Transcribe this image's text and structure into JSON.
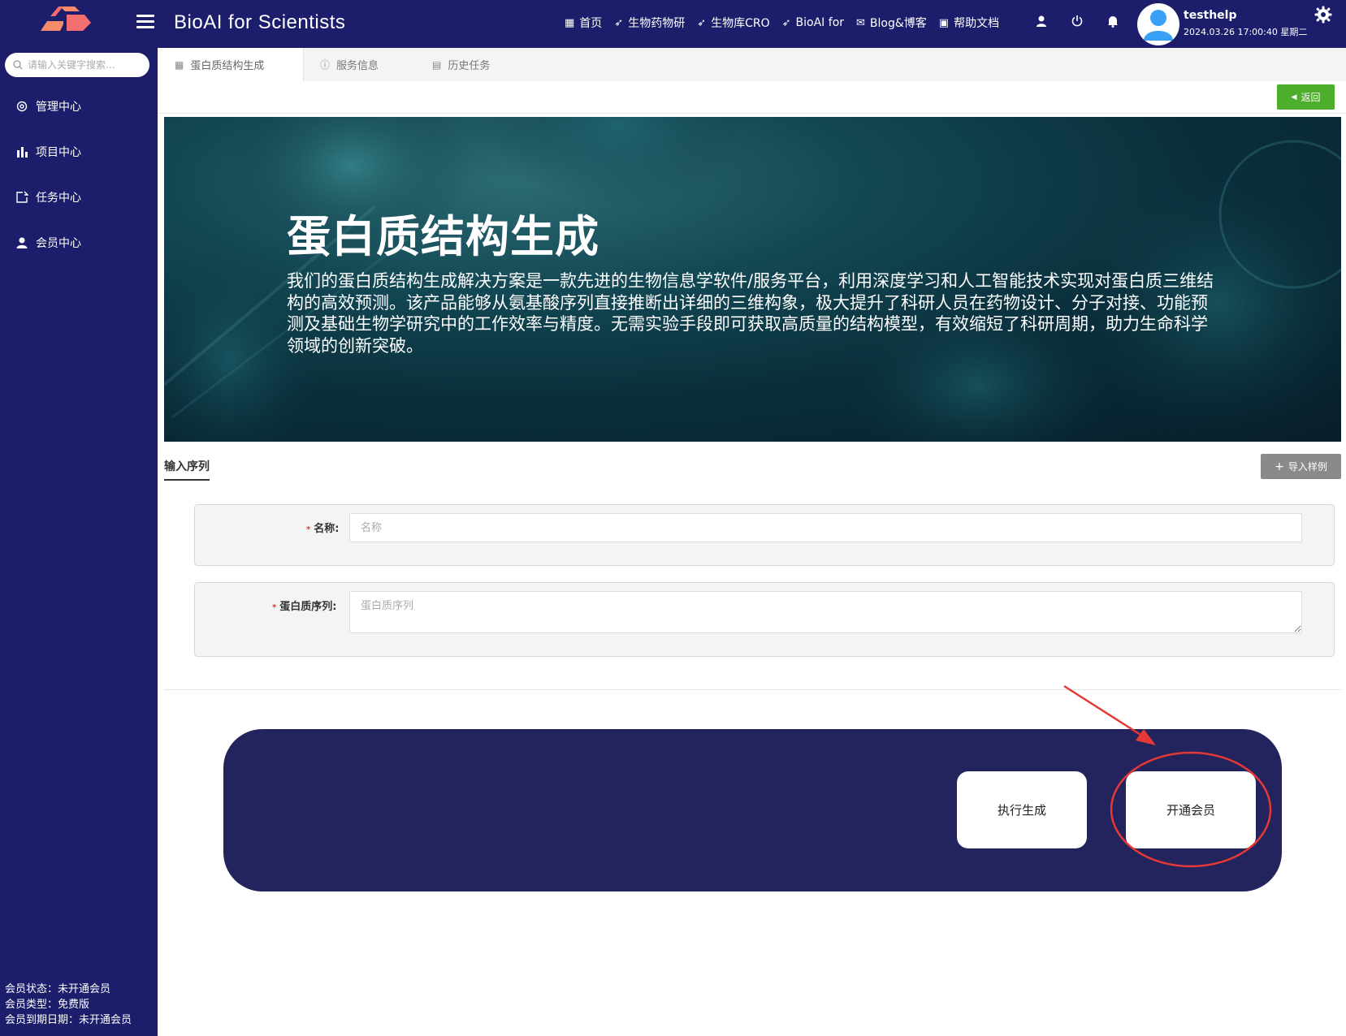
{
  "header": {
    "title": "BioAI for Scientists",
    "nav": [
      {
        "label": "首页",
        "icon": "grid-icon"
      },
      {
        "label": "生物药物研",
        "icon": "send-icon"
      },
      {
        "label": "生物库CRO",
        "icon": "send-icon"
      },
      {
        "label": "BioAI for",
        "icon": "send-icon"
      },
      {
        "label": "Blog&博客",
        "icon": "chat-icon"
      },
      {
        "label": "帮助文档",
        "icon": "doc-icon"
      }
    ],
    "user": {
      "name": "testhelp",
      "datetime": "2024.03.26 17:00:40 星期二"
    }
  },
  "sidebar": {
    "search_placeholder": "请输入关键字搜索...",
    "items": [
      {
        "label": "管理中心",
        "icon": "gear-icon"
      },
      {
        "label": "项目中心",
        "icon": "bar-chart-icon"
      },
      {
        "label": "任务中心",
        "icon": "share-icon"
      },
      {
        "label": "会员中心",
        "icon": "user-icon"
      }
    ],
    "member": {
      "status": "会员状态：未开通会员",
      "type": "会员类型：免费版",
      "expiry": "会员到期日期：未开通会员"
    }
  },
  "tabs": [
    {
      "label": "蛋白质结构生成",
      "icon": "grid-icon",
      "active": true
    },
    {
      "label": "服务信息",
      "icon": "info-icon",
      "active": false
    },
    {
      "label": "历史任务",
      "icon": "doc-icon",
      "active": false
    }
  ],
  "toolbar": {
    "back_label": "返回"
  },
  "banner": {
    "title": "蛋白质结构生成",
    "description": "我们的蛋白质结构生成解决方案是一款先进的生物信息学软件/服务平台，利用深度学习和人工智能技术实现对蛋白质三维结构的高效预测。该产品能够从氨基酸序列直接推断出详细的三维构象，极大提升了科研人员在药物设计、分子对接、功能预测及基础生物学研究中的工作效率与精度。无需实验手段即可获取高质量的结构模型，有效缩短了科研周期，助力生命科学领域的创新突破。"
  },
  "form": {
    "section_title": "输入序列",
    "import_label": "导入样例",
    "name_label": "名称:",
    "name_placeholder": "名称",
    "seq_label": "蛋白质序列:",
    "seq_placeholder": "蛋白质序列"
  },
  "actions": {
    "run_label": "执行生成",
    "member_label": "开通会员"
  },
  "colors": {
    "header_bg": "#1c1d6b",
    "panel_bg": "#23235e",
    "back_btn": "#4cae2a",
    "annotation": "#e53935"
  }
}
